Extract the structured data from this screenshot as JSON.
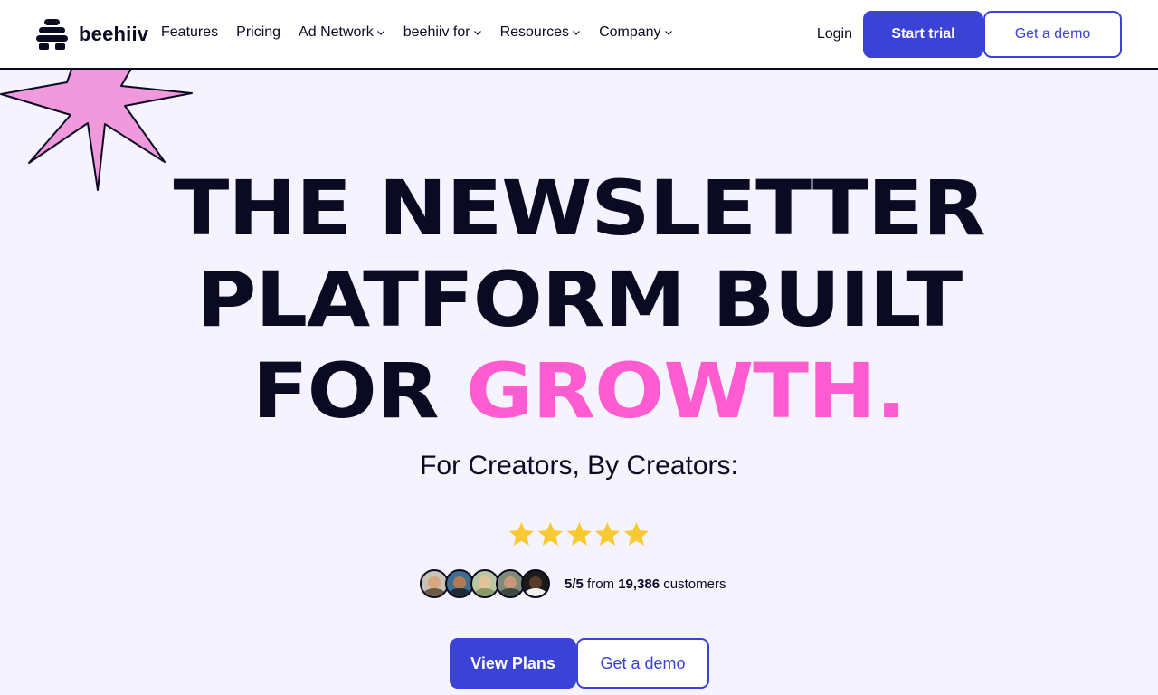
{
  "brand": {
    "name": "beehiiv"
  },
  "nav": {
    "links": [
      {
        "label": "Features",
        "dropdown": false
      },
      {
        "label": "Pricing",
        "dropdown": false
      },
      {
        "label": "Ad Network",
        "dropdown": true
      },
      {
        "label": "beehiiv for",
        "dropdown": true
      },
      {
        "label": "Resources",
        "dropdown": true
      },
      {
        "label": "Company",
        "dropdown": true
      }
    ],
    "login_label": "Login",
    "start_trial_label": "Start trial",
    "get_demo_label": "Get a demo"
  },
  "hero": {
    "line1": "THE NEWSLETTER",
    "line2": "PLATFORM BUILT",
    "line3_prefix": "FOR ",
    "line3_accent": "GROWTH.",
    "subhead": "For Creators, By Creators:"
  },
  "rating": {
    "stars": 5,
    "score": "5/5",
    "from_label": "from",
    "customer_count": "19,386",
    "customers_label": "customers"
  },
  "cta": {
    "view_plans_label": "View Plans",
    "get_demo_label": "Get a demo"
  },
  "colors": {
    "accent_blue": "#3a43d5",
    "accent_pink": "#ff5cd1",
    "star_yellow": "#f9c932",
    "background": "#f5f3fd",
    "ink": "#0a0a23"
  },
  "icons": {
    "logo": "beehive-icon",
    "chevron": "chevron-down-icon",
    "star": "star-icon",
    "decor": "starburst-icon"
  }
}
